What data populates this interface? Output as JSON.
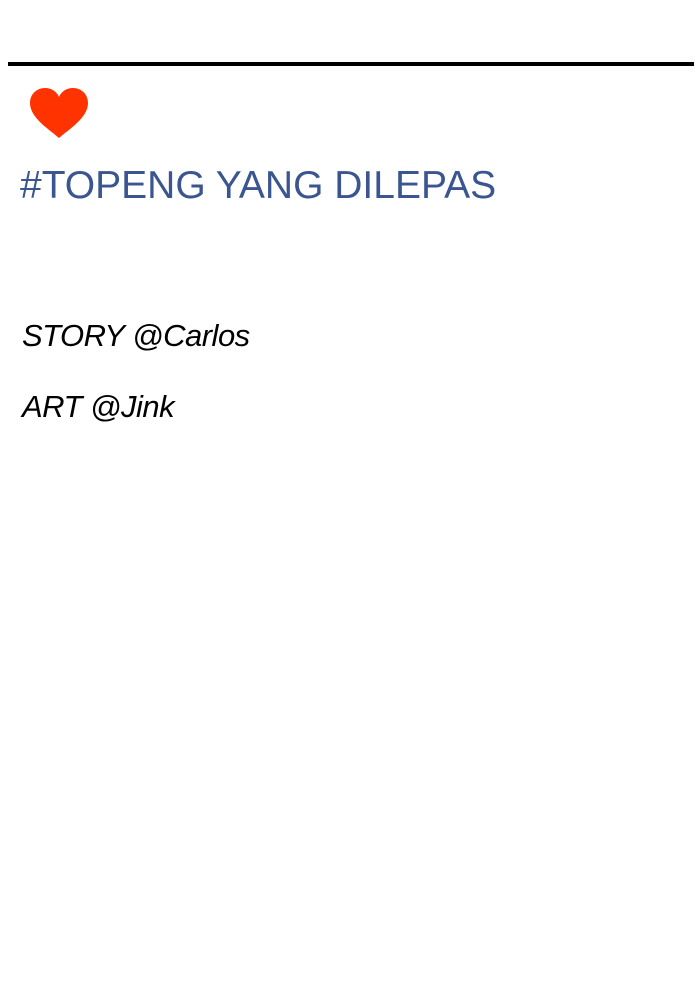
{
  "colors": {
    "heart": "#ff3300",
    "title": "#3a5590",
    "rule": "#000000",
    "text": "#000000",
    "background": "#ffffff"
  },
  "icons": {
    "heart": "heart-icon"
  },
  "post": {
    "title": "#TOPENG YANG DILEPAS",
    "credits": {
      "story": "STORY @Carlos",
      "art": "ART @Jink"
    }
  }
}
